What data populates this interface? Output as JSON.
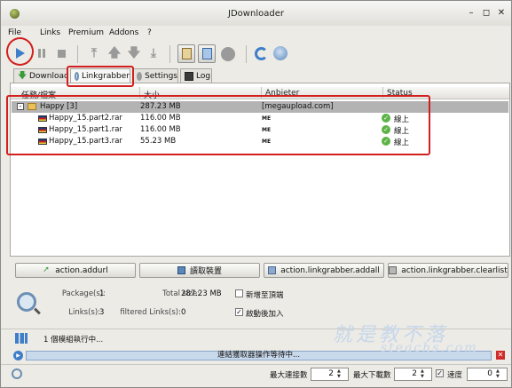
{
  "window": {
    "title": "JDownloader"
  },
  "menu": [
    "File",
    "Links",
    "Premium",
    "Addons",
    "?"
  ],
  "tabs": {
    "download": "Download",
    "linkgrabber": "Linkgrabber",
    "settings": "Settings",
    "log": "Log"
  },
  "table": {
    "headers": [
      "任務/檔案",
      "大小",
      "Anbieter",
      "Status"
    ],
    "package": {
      "name": "Happy [3]",
      "size": "287.23 MB",
      "host": "[megaupload.com]",
      "expander": "-"
    },
    "files": [
      {
        "name": "Happy_15.part2.rar",
        "size": "116.00 MB",
        "host": "ME",
        "status": "線上"
      },
      {
        "name": "Happy_15.part1.rar",
        "size": "116.00 MB",
        "host": "ME",
        "status": "線上"
      },
      {
        "name": "Happy_15.part3.rar",
        "size": "55.23 MB",
        "host": "ME",
        "status": "線上"
      }
    ]
  },
  "actions": {
    "addurl": "action.addurl",
    "load": "讀取裝置",
    "addall": "action.linkgrabber.addall",
    "clearlist": "action.linkgrabber.clearlist"
  },
  "info": {
    "packages_label": "Package(s):",
    "packages_value": "1",
    "total_size_label": "Total size:",
    "total_size_value": "287.23 MB",
    "links_label": "Links(s):",
    "links_value": "3",
    "filtered_label": "filtered Links(s):",
    "filtered_value": "0",
    "add_to_top": "新增至頂端",
    "add_to_top_checked": false,
    "auto_add": "啟動後加入",
    "auto_add_checked": true
  },
  "tasks": {
    "running": "1 個模組執行中...",
    "progress_text": "連結獲取器操作等待中..."
  },
  "statusbar": {
    "max_connections_label": "最大連接數",
    "max_connections_value": "2",
    "max_downloads_label": "最大下載數",
    "max_downloads_value": "2",
    "speed_label": "速度",
    "speed_value": "0"
  },
  "watermark": {
    "line1": "就是教不落",
    "line2": "steachs.com"
  },
  "colors": {
    "highlight_red": "#d21f1f",
    "accent_blue": "#3f7ec8",
    "package_row": "#b3b3b3"
  }
}
